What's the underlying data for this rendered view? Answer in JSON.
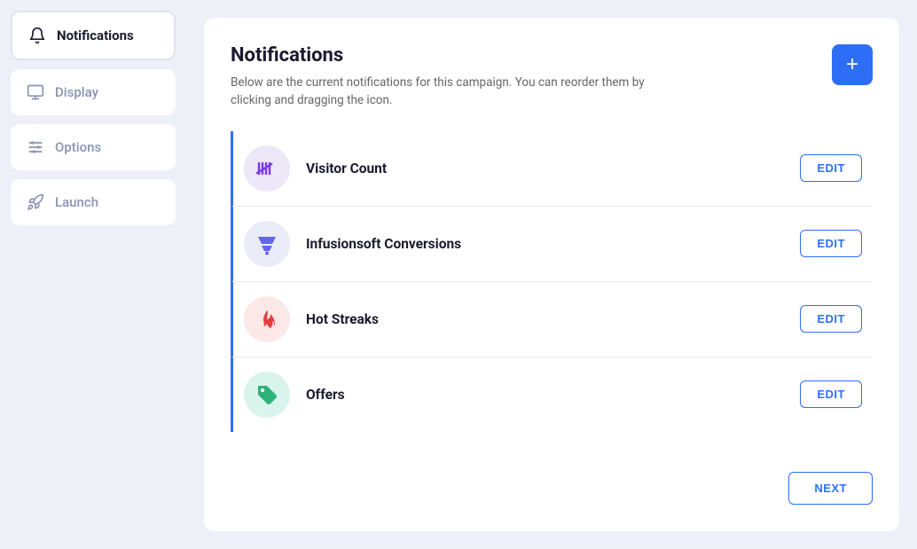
{
  "sidebar": {
    "items": [
      {
        "id": "notifications",
        "label": "Notifications",
        "active": true,
        "icon": "bell"
      },
      {
        "id": "display",
        "label": "Display",
        "active": false,
        "icon": "monitor"
      },
      {
        "id": "options",
        "label": "Options",
        "active": false,
        "icon": "sliders"
      },
      {
        "id": "launch",
        "label": "Launch",
        "active": false,
        "icon": "rocket"
      }
    ]
  },
  "main": {
    "title": "Notifications",
    "description": "Below are the current notifications for this campaign. You can reorder them by clicking and dragging the icon.",
    "add_button_label": "+",
    "notifications": [
      {
        "id": "visitor-count",
        "label": "Visitor Count",
        "icon_type": "tally",
        "icon_bg": "icon-visitor"
      },
      {
        "id": "infusionsoft",
        "label": "Infusionsoft Conversions",
        "icon_type": "funnel",
        "icon_bg": "icon-infusion"
      },
      {
        "id": "hot-streaks",
        "label": "Hot Streaks",
        "icon_type": "flame",
        "icon_bg": "icon-hot"
      },
      {
        "id": "offers",
        "label": "Offers",
        "icon_type": "tag",
        "icon_bg": "icon-offers"
      }
    ],
    "edit_label": "EDIT",
    "next_label": "NEXT"
  }
}
